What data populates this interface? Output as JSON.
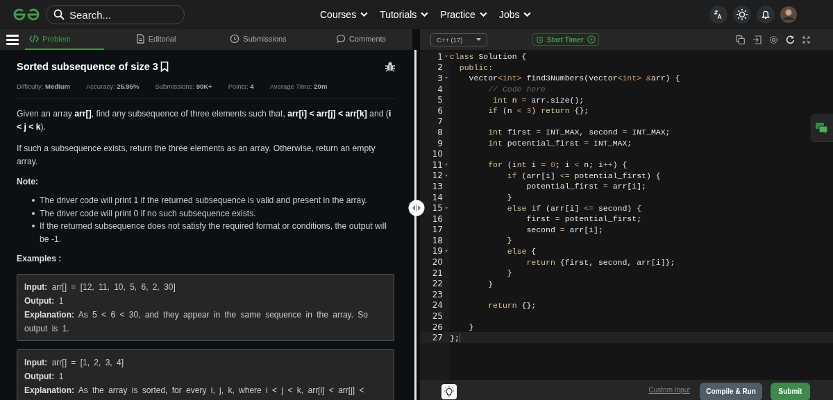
{
  "topbar": {
    "search": {
      "placeholder": "Search..."
    },
    "nav": [
      {
        "label": "Courses"
      },
      {
        "label": "Tutorials"
      },
      {
        "label": "Practice"
      },
      {
        "label": "Jobs"
      }
    ]
  },
  "tabs": [
    {
      "label": "Problem",
      "selected": true
    },
    {
      "label": "Editorial",
      "selected": false
    },
    {
      "label": "Submissions",
      "selected": false
    },
    {
      "label": "Comments",
      "selected": false
    }
  ],
  "problem": {
    "title": "Sorted subsequence of size 3",
    "bookmarked": false,
    "meta": [
      "Difficulty: **Medium**",
      "Accuracy: **25.95%**",
      "Submissions: **90K+**",
      "Points: **4**",
      "Average Time: **20m**"
    ],
    "paragraphs": [
      "Given an array **arr[]**, find any subsequence of three elements such that, **arr[i] < arr[j] < arr[k]** and (**i < j < k**).",
      "If such a subsequence exists, return the three elements as an array. Otherwise, return an empty array."
    ],
    "note_heading": "Note:",
    "notes": [
      "The driver code will print 1 if the returned subsequence is valid and present in the array.",
      "The driver code will print 0 if no such subsequence exists.",
      "If the returned subsequence does not satisfy the required format or conditions, the output will be -1."
    ],
    "examples_heading": "Examples :",
    "examples": [
      [
        "**Input:** arr[] = [12, 11, 10, 5, 6, 2, 30]",
        "**Output:** 1",
        "**Explanation:** As 5 < 6 < 30, and they  appear in the same sequence in the array. So output is 1."
      ],
      [
        "**Input:** arr[] = [1, 2, 3, 4]",
        "**Output:** 1",
        "**Explanation:** As the array is sorted, for every i, j, k, where i < j < k, arr[i] < arr[j] <"
      ]
    ]
  },
  "editor": {
    "language": "C++ (17)",
    "timer": "Start Timer",
    "lines": [
      {
        "n": "1",
        "fold": true,
        "tokens": [
          {
            "kind": "kw",
            "text": "class"
          },
          {
            "kind": "tx",
            "text": " Solution {"
          }
        ]
      },
      {
        "n": "2",
        "tokens": [
          {
            "kind": "kw",
            "text": "  public:"
          }
        ]
      },
      {
        "n": "3",
        "fold": true,
        "tokens": [
          {
            "kind": "tx",
            "text": "    vector"
          },
          {
            "kind": "op",
            "text": "<int>"
          },
          {
            "kind": "tx",
            "text": " find3Numbers(vector"
          },
          {
            "kind": "op",
            "text": "<int>"
          },
          {
            "kind": "op",
            "text": " &"
          },
          {
            "kind": "tx",
            "text": "arr) {"
          }
        ]
      },
      {
        "n": "4",
        "tokens": [
          {
            "kind": "cm",
            "text": "        // Code here"
          }
        ]
      },
      {
        "n": "5",
        "tokens": [
          {
            "kind": "kw",
            "text": "         int"
          },
          {
            "kind": "tx",
            "text": " n "
          },
          {
            "kind": "op",
            "text": "="
          },
          {
            "kind": "tx",
            "text": " arr.size();"
          }
        ]
      },
      {
        "n": "6",
        "tokens": [
          {
            "kind": "kw",
            "text": "        if"
          },
          {
            "kind": "tx",
            "text": " (n "
          },
          {
            "kind": "op",
            "text": "<"
          },
          {
            "kind": "num",
            "text": " 3"
          },
          {
            "kind": "tx",
            "text": ") "
          },
          {
            "kind": "kw",
            "text": "return"
          },
          {
            "kind": "tx",
            "text": " {};"
          }
        ]
      },
      {
        "n": "7"
      },
      {
        "n": "8",
        "tokens": [
          {
            "kind": "kw",
            "text": "        int"
          },
          {
            "kind": "tx",
            "text": " first "
          },
          {
            "kind": "op",
            "text": "="
          },
          {
            "kind": "tx",
            "text": " INT_MAX, second "
          },
          {
            "kind": "op",
            "text": "="
          },
          {
            "kind": "tx",
            "text": " INT_MAX;"
          }
        ]
      },
      {
        "n": "9",
        "tokens": [
          {
            "kind": "kw",
            "text": "        int"
          },
          {
            "kind": "tx",
            "text": " potential_first "
          },
          {
            "kind": "op",
            "text": "="
          },
          {
            "kind": "tx",
            "text": " INT_MAX;"
          }
        ]
      },
      {
        "n": "10"
      },
      {
        "n": "11",
        "fold": true,
        "tokens": [
          {
            "kind": "kw",
            "text": "        for"
          },
          {
            "kind": "tx",
            "text": " ("
          },
          {
            "kind": "kw",
            "text": "int"
          },
          {
            "kind": "tx",
            "text": " i "
          },
          {
            "kind": "op",
            "text": "="
          },
          {
            "kind": "num",
            "text": " 0"
          },
          {
            "kind": "tx",
            "text": "; i "
          },
          {
            "kind": "op",
            "text": "<"
          },
          {
            "kind": "tx",
            "text": " n; i"
          },
          {
            "kind": "op",
            "text": "++"
          },
          {
            "kind": "tx",
            "text": ") {"
          }
        ]
      },
      {
        "n": "12",
        "fold": true,
        "tokens": [
          {
            "kind": "kw",
            "text": "            if"
          },
          {
            "kind": "tx",
            "text": " (arr[i] "
          },
          {
            "kind": "op",
            "text": "<="
          },
          {
            "kind": "tx",
            "text": " potential_first) {"
          }
        ]
      },
      {
        "n": "13",
        "tokens": [
          {
            "kind": "tx",
            "text": "                potential_first "
          },
          {
            "kind": "op",
            "text": "="
          },
          {
            "kind": "tx",
            "text": " arr[i];"
          }
        ]
      },
      {
        "n": "14",
        "tokens": [
          {
            "kind": "tx",
            "text": "            }"
          }
        ]
      },
      {
        "n": "15",
        "fold": true,
        "tokens": [
          {
            "kind": "kw",
            "text": "            else if"
          },
          {
            "kind": "tx",
            "text": " (arr[i] "
          },
          {
            "kind": "op",
            "text": "<="
          },
          {
            "kind": "tx",
            "text": " second) {"
          }
        ]
      },
      {
        "n": "16",
        "tokens": [
          {
            "kind": "tx",
            "text": "                first "
          },
          {
            "kind": "op",
            "text": "="
          },
          {
            "kind": "tx",
            "text": " potential_first;"
          }
        ]
      },
      {
        "n": "17",
        "tokens": [
          {
            "kind": "tx",
            "text": "                second "
          },
          {
            "kind": "op",
            "text": "="
          },
          {
            "kind": "tx",
            "text": " arr[i];"
          }
        ]
      },
      {
        "n": "18",
        "tokens": [
          {
            "kind": "tx",
            "text": "            }"
          }
        ]
      },
      {
        "n": "19",
        "fold": true,
        "tokens": [
          {
            "kind": "kw",
            "text": "            else"
          },
          {
            "kind": "tx",
            "text": " {"
          }
        ]
      },
      {
        "n": "20",
        "tokens": [
          {
            "kind": "kw",
            "text": "                return"
          },
          {
            "kind": "tx",
            "text": " {first, second, arr[i]};"
          }
        ]
      },
      {
        "n": "21",
        "tokens": [
          {
            "kind": "tx",
            "text": "            }"
          }
        ]
      },
      {
        "n": "22",
        "tokens": [
          {
            "kind": "tx",
            "text": "        }"
          }
        ]
      },
      {
        "n": "23"
      },
      {
        "n": "24",
        "tokens": [
          {
            "kind": "kw",
            "text": "        return"
          },
          {
            "kind": "tx",
            "text": " {};"
          }
        ]
      },
      {
        "n": "25"
      },
      {
        "n": "26",
        "tokens": [
          {
            "kind": "tx",
            "text": "    }"
          }
        ]
      },
      {
        "n": "27",
        "current": true,
        "tokens": [
          {
            "kind": "tx",
            "text": "};"
          }
        ]
      }
    ],
    "custom_input": "Custom Input",
    "compile": "Compile & Run",
    "submit": "Submit"
  }
}
